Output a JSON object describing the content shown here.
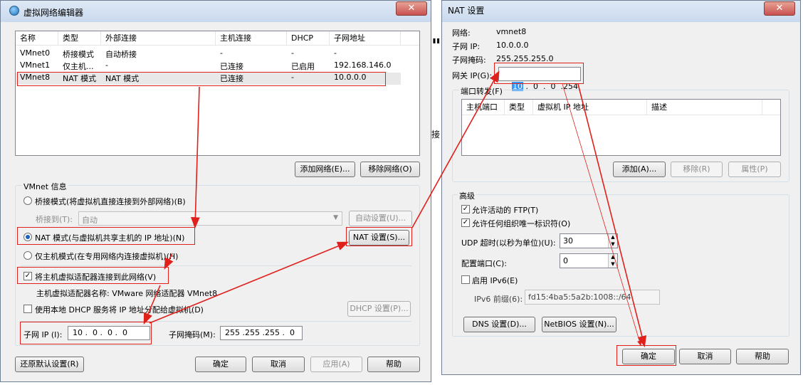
{
  "left": {
    "title": "虚拟网络编辑器",
    "close": "✕",
    "table": {
      "columns": [
        "名称",
        "类型",
        "外部连接",
        "主机连接",
        "DHCP",
        "子网地址"
      ],
      "rows": [
        [
          "VMnet0",
          "桥接模式",
          "自动桥接",
          "-",
          "-",
          "-"
        ],
        [
          "VMnet1",
          "仅主机...",
          "-",
          "已连接",
          "已启用",
          "192.168.146.0"
        ],
        [
          "VMnet8",
          "NAT 模式",
          "NAT 模式",
          "已连接",
          "-",
          "10.0.0.0"
        ]
      ]
    },
    "add_network": "添加网络(E)...",
    "remove_network": "移除网络(O)",
    "vmnet_info": "VMnet 信息",
    "bridged": "桥接模式(将虚拟机直接连接到外部网络)(B)",
    "bridged_to": "桥接到(T):",
    "bridged_value": "自动",
    "auto_settings": "自动设置(U)...",
    "nat": "NAT 模式(与虚拟机共享主机的 IP 地址)(N)",
    "nat_settings": "NAT 设置(S)...",
    "host_only": "仅主机模式(在专用网络内连接虚拟机)(H)",
    "connect_adapter": "将主机虚拟适配器连接到此网络(V)",
    "adapter_name": "主机虚拟适配器名称: VMware 网络适配器 VMnet8",
    "use_dhcp": "使用本地 DHCP 服务将 IP 地址分配给虚拟机(D)",
    "dhcp_settings": "DHCP 设置(P)...",
    "subnet_ip_label": "子网 IP (I):",
    "subnet_ip": "10 .  0 .  0 .  0",
    "subnet_mask_label": "子网掩码(M):",
    "subnet_mask": "255 .255 .255 .  0",
    "restore_defaults": "还原默认设置(R)",
    "ok": "确定",
    "cancel": "取消",
    "apply": "应用(A)",
    "help": "帮助"
  },
  "right": {
    "title": "NAT 设置",
    "close": "✕",
    "network_label": "网络:",
    "network_value": "vmnet8",
    "subnet_ip_label": "子网 IP:",
    "subnet_ip_value": "10.0.0.0",
    "subnet_mask_label": "子网掩码:",
    "subnet_mask_value": "255.255.255.0",
    "gateway_label": "网关 IP(G):",
    "gateway_octet1": "10",
    "gateway_rest": " .  0  .  0  .254",
    "port_forwarding": "端口转发(F)",
    "pf_columns": [
      "主机端口",
      "类型",
      "虚拟机 IP 地址",
      "描述"
    ],
    "add": "添加(A)...",
    "remove": "移除(R)",
    "properties": "属性(P)",
    "advanced": "高级",
    "allow_ftp": "允许活动的 FTP(T)",
    "allow_oui": "允许任何组织唯一标识符(O)",
    "udp_timeout_label": "UDP 超时(以秒为单位)(U):",
    "udp_timeout": "30",
    "config_port_label": "配置端口(C):",
    "config_port": "0",
    "enable_ipv6": "启用 IPv6(E)",
    "ipv6_prefix_label": "IPv6 前缀(6):",
    "ipv6_prefix": "fd15:4ba5:5a2b:1008::/64",
    "dns": "DNS 设置(D)...",
    "netbios": "NetBIOS 设置(N)...",
    "ok": "确定",
    "cancel": "取消",
    "help": "帮助"
  },
  "background_fragments": {
    "quote": "\"",
    "frag": "接"
  },
  "colors": {
    "annotation": "#e0201b",
    "selection": "#3399ff"
  }
}
